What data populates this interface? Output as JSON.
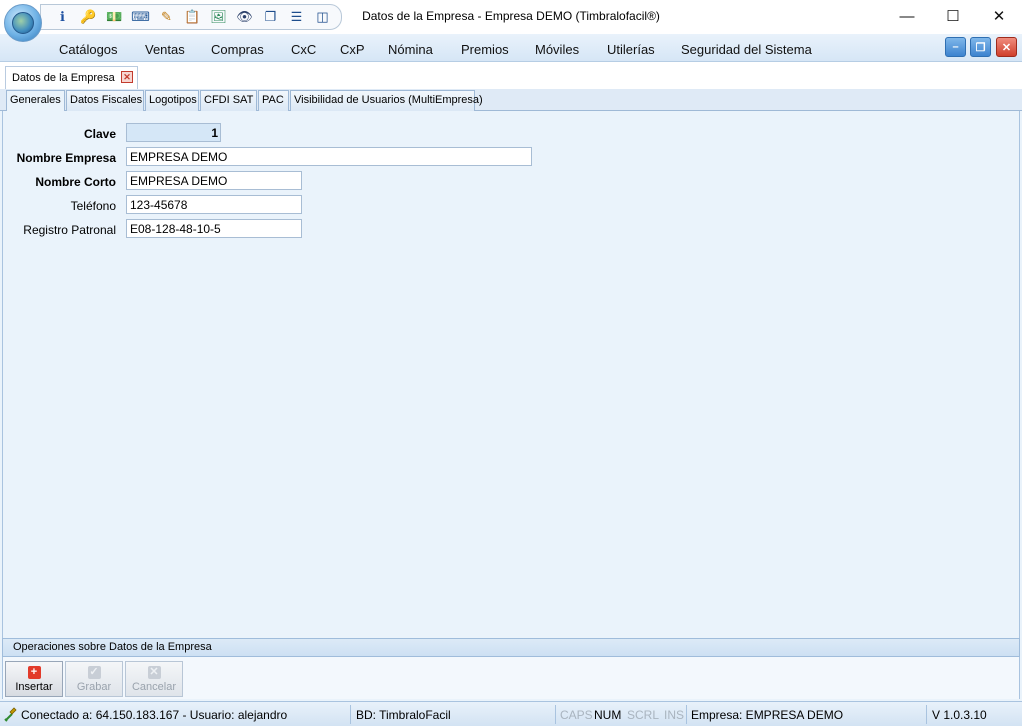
{
  "window": {
    "title": "Datos de la Empresa - Empresa DEMO (Timbralofacil®)",
    "controls": {
      "minimize": "—",
      "maximize": "☐",
      "close": "✕"
    }
  },
  "quick_access": [
    {
      "icon": "info-icon",
      "glyph": "ℹ",
      "color": "#1c4fa0"
    },
    {
      "icon": "key-icon",
      "glyph": "🔑",
      "color": "#c49a00"
    },
    {
      "icon": "money-icon",
      "glyph": "💵",
      "color": "#2f8a2f"
    },
    {
      "icon": "keyboard-icon",
      "glyph": "⌨",
      "color": "#2a5d9a"
    },
    {
      "icon": "edit-document-icon",
      "glyph": "✎",
      "color": "#c07a10"
    },
    {
      "icon": "notes-icon",
      "glyph": "📋",
      "color": "#3a6aa8"
    },
    {
      "icon": "image-icon",
      "glyph": "🖼",
      "color": "#2e8a5a"
    },
    {
      "icon": "eye-icon",
      "glyph": "👁",
      "color": "#2a3f6a"
    },
    {
      "icon": "cascade-windows-icon",
      "glyph": "❐",
      "color": "#1e4d8c"
    },
    {
      "icon": "tile-horizontal-icon",
      "glyph": "☰",
      "color": "#1e4d8c"
    },
    {
      "icon": "tile-vertical-icon",
      "glyph": "◫",
      "color": "#1e4d8c"
    }
  ],
  "menu": [
    "Catálogos",
    "Ventas",
    "Compras",
    "CxC",
    "CxP",
    "Nómina",
    "Premios",
    "Móviles",
    "Utilerías",
    "Seguridad del Sistema"
  ],
  "mdi_controls": {
    "minimize": "–",
    "restore": "❐",
    "close": "✕"
  },
  "document_tab": {
    "label": "Datos de la Empresa",
    "close": "✕"
  },
  "tabs": [
    "Generales",
    "Datos Fiscales",
    "Logotipos",
    "CFDI SAT",
    "PAC",
    "Visibilidad de Usuarios (MultiEmpresa)"
  ],
  "form": {
    "clave": {
      "label": "Clave",
      "value": "1"
    },
    "nombre_empresa": {
      "label": "Nombre Empresa",
      "value": "EMPRESA DEMO"
    },
    "nombre_corto": {
      "label": "Nombre Corto",
      "value": "EMPRESA DEMO"
    },
    "telefono": {
      "label": "Teléfono",
      "value": "123-45678"
    },
    "registro_patronal": {
      "label": "Registro Patronal",
      "value": "E08-128-48-10-5"
    }
  },
  "operations": {
    "header": "Operaciones sobre Datos de la Empresa",
    "insert": {
      "label": "Insertar",
      "glyph": "+"
    },
    "save": {
      "label": "Grabar",
      "glyph": "✓"
    },
    "cancel": {
      "label": "Cancelar",
      "glyph": "✕"
    }
  },
  "status": {
    "connection": "Conectado a: 64.150.183.167 - Usuario: alejandro",
    "database": "BD: TimbraloFacil",
    "caps": "CAPS",
    "num": "NUM",
    "scrl": "SCRL",
    "ins": "INS",
    "company": "Empresa: EMPRESA DEMO",
    "version": "V 1.0.3.10"
  }
}
